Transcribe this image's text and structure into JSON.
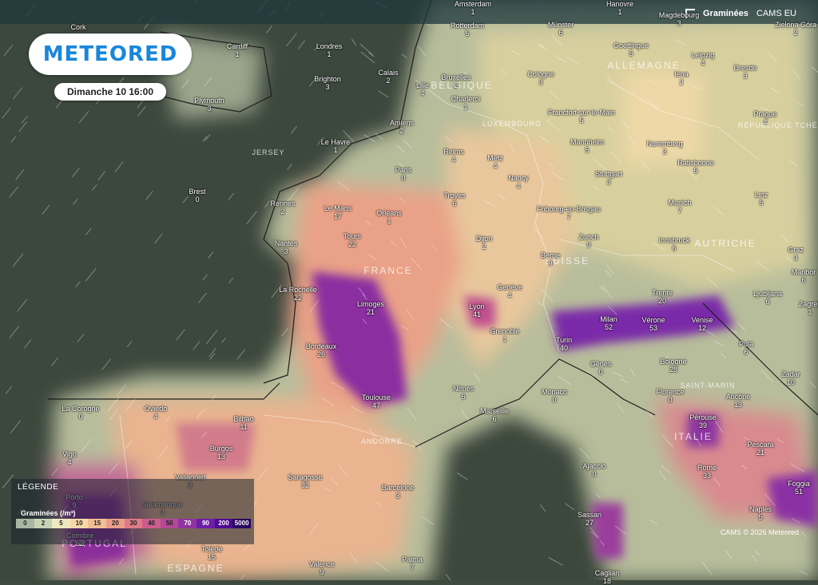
{
  "header": {
    "logo": "METEORED",
    "date": "Dimanche 10 16:00"
  },
  "layers": {
    "active": "Graminées",
    "source": "CAMS EU"
  },
  "legend": {
    "title": "LÉGENDE",
    "variable": "Graminées (/m³)",
    "stops": [
      "0",
      "2",
      "5",
      "10",
      "15",
      "20",
      "30",
      "40",
      "50",
      "70",
      "90",
      "200",
      "5000"
    ],
    "colors": [
      "#a9b5a3",
      "#c7d3b5",
      "#efe9c0",
      "#f7d9a8",
      "#f2be96",
      "#ec9e8a",
      "#dd7a86",
      "#cc5c8c",
      "#b24896",
      "#8f34a0",
      "#6c1ea6",
      "#4e0a90",
      "#2a0760"
    ]
  },
  "credit": "CAMS © 2026 Meteored",
  "regions": [
    "ALLEMAGNE",
    "BELGIQUE",
    "LUXEMBOURG",
    "RÉPUBLIQUE TCHÈQUE",
    "FRANCE",
    "SUISSE",
    "AUTRICHE",
    "ITALIE",
    "SAINT-MARIN",
    "ANDORRE",
    "PORTUGAL",
    "ESPAGNE",
    "JERSEY"
  ],
  "cities": [
    {
      "n": "Amsterdam",
      "v": "1"
    },
    {
      "n": "Hanovre",
      "v": "1"
    },
    {
      "n": "Magdebourg",
      "v": "3"
    },
    {
      "n": "Zielona Góra",
      "v": "2"
    },
    {
      "n": "Rotterdam",
      "v": "5"
    },
    {
      "n": "Münster",
      "v": "6"
    },
    {
      "n": "Goettingue",
      "v": "5"
    },
    {
      "n": "Leipzig",
      "v": "4"
    },
    {
      "n": "Cork",
      "v": ""
    },
    {
      "n": "Cardiff",
      "v": "1"
    },
    {
      "n": "Londres",
      "v": "1"
    },
    {
      "n": "Calais",
      "v": "2"
    },
    {
      "n": "Bruxelles",
      "v": "2"
    },
    {
      "n": "Lille",
      "v": "4"
    },
    {
      "n": "Cologne",
      "v": "3"
    },
    {
      "n": "Iéna",
      "v": "2"
    },
    {
      "n": "Dresde",
      "v": "3"
    },
    {
      "n": "Plymouth",
      "v": "3"
    },
    {
      "n": "Brighton",
      "v": "3"
    },
    {
      "n": "Charleroi",
      "v": "1"
    },
    {
      "n": "Francfort-sur-le-Main",
      "v": "5"
    },
    {
      "n": "Prague",
      "v": "4"
    },
    {
      "n": "Amiens",
      "v": "2"
    },
    {
      "n": "Le Havre",
      "v": "1"
    },
    {
      "n": "Mannheim",
      "v": "5"
    },
    {
      "n": "Nuremberg",
      "v": "3"
    },
    {
      "n": "Reims",
      "v": "4"
    },
    {
      "n": "Metz",
      "v": "4"
    },
    {
      "n": "Nancy",
      "v": "4"
    },
    {
      "n": "Stuttgart",
      "v": "3"
    },
    {
      "n": "Ratisbonne",
      "v": "5"
    },
    {
      "n": "Paris",
      "v": "0"
    },
    {
      "n": "Brest",
      "v": "0"
    },
    {
      "n": "Rennes",
      "v": "2"
    },
    {
      "n": "Troyes",
      "v": "6"
    },
    {
      "n": "Linz",
      "v": "5"
    },
    {
      "n": "Le Mans",
      "v": "17"
    },
    {
      "n": "Orléans",
      "v": "1"
    },
    {
      "n": "Fribourg-en-Brisgau",
      "v": "7"
    },
    {
      "n": "Munich",
      "v": "7"
    },
    {
      "n": "Tours",
      "v": "22"
    },
    {
      "n": "Dijon",
      "v": "2"
    },
    {
      "n": "Zurich",
      "v": "9"
    },
    {
      "n": "Innsbruck",
      "v": "6"
    },
    {
      "n": "Nantes",
      "v": "3"
    },
    {
      "n": "Berne",
      "v": "9"
    },
    {
      "n": "Graz",
      "v": "3"
    },
    {
      "n": "Maribor",
      "v": "6"
    },
    {
      "n": "La Rochelle",
      "v": "22"
    },
    {
      "n": "Genève",
      "v": "4"
    },
    {
      "n": "Trente",
      "v": "20"
    },
    {
      "n": "Ljubljana",
      "v": "6"
    },
    {
      "n": "Limoges",
      "v": "21"
    },
    {
      "n": "Lyon",
      "v": "41"
    },
    {
      "n": "Milan",
      "v": "52"
    },
    {
      "n": "Vérone",
      "v": "53"
    },
    {
      "n": "Venise",
      "v": "12"
    },
    {
      "n": "Zagreb",
      "v": "1"
    },
    {
      "n": "Grenoble",
      "v": "1"
    },
    {
      "n": "Pula",
      "v": "6"
    },
    {
      "n": "Bordeaux",
      "v": "26"
    },
    {
      "n": "Turin",
      "v": "40"
    },
    {
      "n": "Gênes",
      "v": "0"
    },
    {
      "n": "Bologne",
      "v": "28"
    },
    {
      "n": "Zadar",
      "v": "10"
    },
    {
      "n": "Toulouse",
      "v": "47"
    },
    {
      "n": "Nîmes",
      "v": "6"
    },
    {
      "n": "Monaco",
      "v": "0"
    },
    {
      "n": "Florence",
      "v": "0"
    },
    {
      "n": "Ancône",
      "v": "13"
    },
    {
      "n": "La Corogne",
      "v": "0"
    },
    {
      "n": "Oviedo",
      "v": "4"
    },
    {
      "n": "Bilbao",
      "v": "11"
    },
    {
      "n": "Marseille",
      "v": "6"
    },
    {
      "n": "Pérouse",
      "v": "39"
    },
    {
      "n": "Burgos",
      "v": "13"
    },
    {
      "n": "Pescara",
      "v": "21"
    },
    {
      "n": "Vigo",
      "v": "4"
    },
    {
      "n": "Ajaccio",
      "v": "0"
    },
    {
      "n": "Valladolid",
      "v": "9"
    },
    {
      "n": "Saragosse",
      "v": "32"
    },
    {
      "n": "Rome",
      "v": "33"
    },
    {
      "n": "Foggia",
      "v": "51"
    },
    {
      "n": "Porto",
      "v": "9"
    },
    {
      "n": "Barcelone",
      "v": "3"
    },
    {
      "n": "Salamanque",
      "v": "3"
    },
    {
      "n": "Naples",
      "v": "5"
    },
    {
      "n": "Sassari",
      "v": "27"
    },
    {
      "n": "Coimbre",
      "v": "52"
    },
    {
      "n": "Tolède",
      "v": "15"
    },
    {
      "n": "Valence",
      "v": "9"
    },
    {
      "n": "Palma",
      "v": "7"
    },
    {
      "n": "Cagliari",
      "v": "18"
    }
  ]
}
